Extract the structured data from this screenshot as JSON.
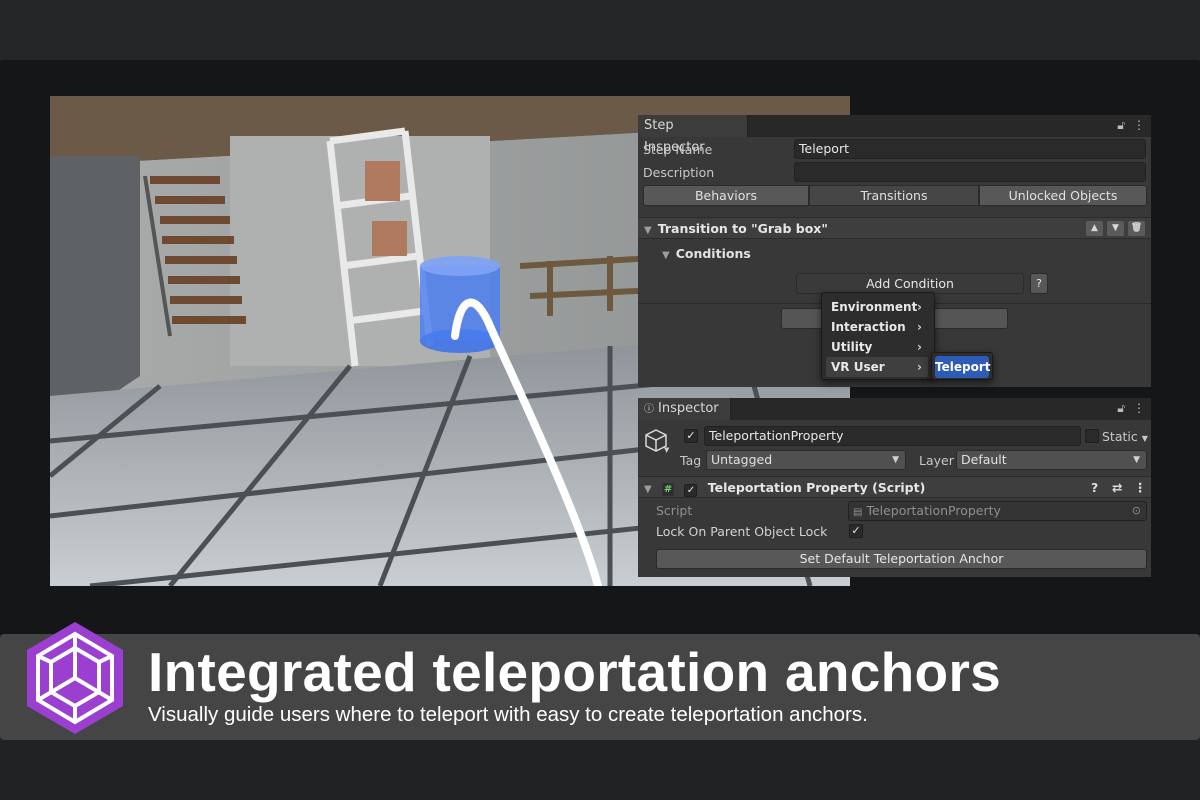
{
  "colors": {
    "background": "#202123",
    "banner": "#454545",
    "accent_purple": "#9a3fd0",
    "selection_blue": "#2d5cb7",
    "teleport_anchor": "#4a7df0"
  },
  "step_inspector": {
    "tab_title": "Step Inspector",
    "step_name_label": "Step Name",
    "step_name_value": "Teleport",
    "description_label": "Description",
    "description_value": "",
    "tabs": [
      "Behaviors",
      "Transitions",
      "Unlocked Objects"
    ],
    "active_tab": "Transitions",
    "transition_title": "Transition to \"Grab box\"",
    "conditions_label": "Conditions",
    "add_condition_label": "Add Condition",
    "help_label": "?",
    "menu_items": [
      "Environment",
      "Interaction",
      "Utility",
      "VR User"
    ],
    "submenu_item": "Teleport"
  },
  "inspector": {
    "tab_title": "Inspector",
    "object_name": "TeleportationProperty",
    "static_label": "Static",
    "tag_label": "Tag",
    "tag_value": "Untagged",
    "layer_label": "Layer",
    "layer_value": "Default",
    "component_title": "Teleportation Property (Script)",
    "script_label": "Script",
    "script_value": "TeleportationProperty",
    "lock_label": "Lock On Parent Object Lock",
    "lock_checked": true,
    "set_default_button": "Set Default Teleportation Anchor"
  },
  "banner": {
    "title": "Integrated teleportation anchors",
    "subtitle": "Visually guide users where to teleport with easy to create teleportation anchors."
  },
  "icons": [
    "lock-icon",
    "kebab-menu-icon",
    "info-icon",
    "cube-icon",
    "script-hash-icon",
    "help-icon",
    "settings-sliders-icon",
    "object-picker-icon",
    "chevron-right-icon",
    "logo-icon"
  ]
}
